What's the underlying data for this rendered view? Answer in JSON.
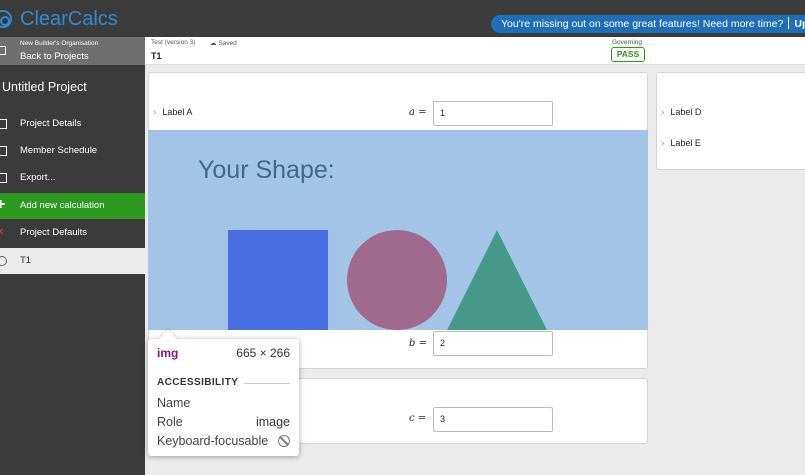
{
  "app": {
    "logo": "ClearCalcs"
  },
  "promo": {
    "text": "You're missing out on some great features! Need more time?",
    "upgrade": "Upgrade"
  },
  "sidebar": {
    "organisation": "New Builder's Organisation",
    "back_label": "Back to Projects",
    "project_name": "Untitled Project",
    "items": [
      {
        "label": "Project Details",
        "icon": "gear-icon"
      },
      {
        "label": "Member Schedule",
        "icon": "table-icon"
      },
      {
        "label": "Export...",
        "icon": "printer-icon"
      },
      {
        "label": "Add new calculation",
        "icon": "plus-icon"
      },
      {
        "label": "Project Defaults",
        "icon": "x-icon"
      },
      {
        "label": "T1",
        "icon": "calc-icon"
      }
    ]
  },
  "status": {
    "version": "Test (version 3)",
    "saved": "Saved",
    "calc_name": "T1",
    "governing_label": "Governing",
    "result": "PASS"
  },
  "inputs": {
    "a": {
      "label": "Label A",
      "symbol": "a",
      "value": "1"
    },
    "b": {
      "symbol": "b",
      "value": "2"
    },
    "c": {
      "symbol": "c",
      "value": "3"
    },
    "d": {
      "label": "Label D"
    },
    "e": {
      "label": "Label E"
    }
  },
  "shape": {
    "title": "Your Shape:"
  },
  "tooltip": {
    "tag": "img",
    "size": "665 × 266",
    "heading": "ACCESSIBILITY",
    "name_label": "Name",
    "role_label": "Role",
    "role_value": "image",
    "focus_label": "Keyboard-focusable"
  },
  "colors": {
    "brand": "#2d8bd6",
    "accent_green": "#2b9a1f",
    "shape_bg": "#a3c4e7",
    "square": "#4a6fe3",
    "circle": "#a0698e",
    "triangle": "#479a8a"
  }
}
